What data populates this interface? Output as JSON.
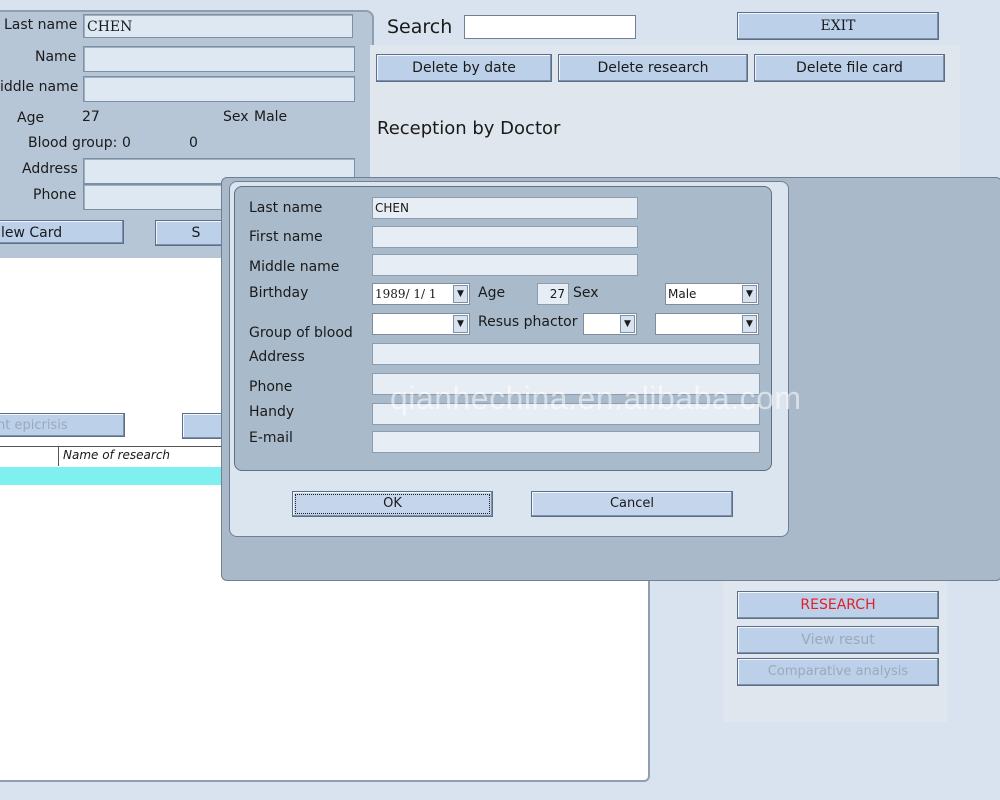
{
  "patient_card": {
    "last_name_label": "Last name",
    "last_name_value": "CHEN",
    "name_label": "Name",
    "middle_name_label": "iddle name",
    "age_label": "Age",
    "age_value": "27",
    "sex_label": "Sex",
    "sex_value": "Male",
    "blood_group_label": "Blood group:",
    "blood_group_value_1": "0",
    "blood_group_value_2": "0",
    "address_label": "Address",
    "phone_label": "Phone",
    "new_card_button": "lew Card",
    "second_button": "S"
  },
  "left_list": {
    "epicrisis_button": "nt epicrisis",
    "column_name_of_research": "Name of research"
  },
  "top_bar": {
    "search_label": "Search",
    "search_value": "",
    "exit_button": "EXIT",
    "delete_by_date_button": "Delete by date",
    "delete_research_button": "Delete research",
    "delete_file_card_button": "Delete file card",
    "reception_title": "Reception by Doctor"
  },
  "right_buttons": {
    "research": "RESEARCH",
    "view_result": "View resut",
    "comparative_analysis": "Comparative analysis"
  },
  "dialog": {
    "last_name_label": "Last name",
    "last_name_value": "CHEN",
    "first_name_label": "First name",
    "first_name_value": "",
    "middle_name_label": "Middle name",
    "middle_name_value": "",
    "birthday_label": "Birthday",
    "birthday_value": "1989/ 1/ 1",
    "age_label": "Age",
    "age_value": "27",
    "sex_label": "Sex",
    "sex_value": "Male",
    "group_of_blood_label": "Group of blood",
    "group_of_blood_value": "",
    "resus_label": "Resus phactor",
    "resus_value_1": "",
    "resus_value_2": "",
    "address_label": "Address",
    "phone_label": "Phone",
    "handy_label": "Handy",
    "email_label": "E-mail",
    "ok_button": "OK",
    "cancel_button": "Cancel"
  },
  "watermark": "qianhechina.en.alibaba.com",
  "colors": {
    "research_text": "#e0202a",
    "disabled_text": "#9aa9bb",
    "list_highlight": "#7ff0f0"
  }
}
